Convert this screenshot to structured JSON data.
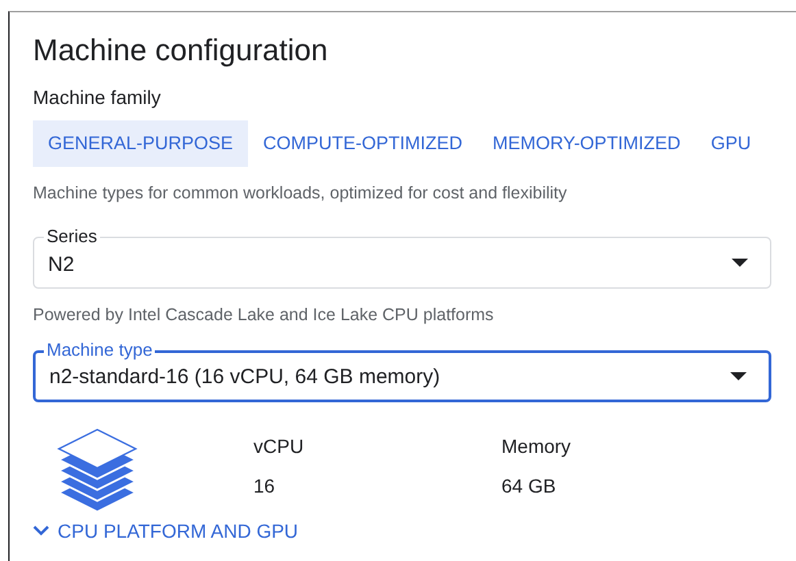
{
  "title": "Machine configuration",
  "machine_family": {
    "label": "Machine family",
    "tabs": [
      {
        "label": "GENERAL-PURPOSE",
        "selected": true
      },
      {
        "label": "COMPUTE-OPTIMIZED",
        "selected": false
      },
      {
        "label": "MEMORY-OPTIMIZED",
        "selected": false
      },
      {
        "label": "GPU",
        "selected": false
      }
    ],
    "description": "Machine types for common workloads, optimized for cost and flexibility"
  },
  "fields": [
    {
      "label": "Series",
      "value": "N2",
      "focused": false,
      "helper": "Powered by Intel Cascade Lake and Ice Lake CPU platforms"
    },
    {
      "label": "Machine type",
      "value": "n2-standard-16 (16 vCPU, 64 GB memory)",
      "focused": true
    }
  ],
  "specs": [
    {
      "name": "vCPU",
      "value": "16"
    },
    {
      "name": "Memory",
      "value": "64 GB"
    }
  ],
  "expander": {
    "label": "CPU PLATFORM AND GPU",
    "expanded": false
  }
}
